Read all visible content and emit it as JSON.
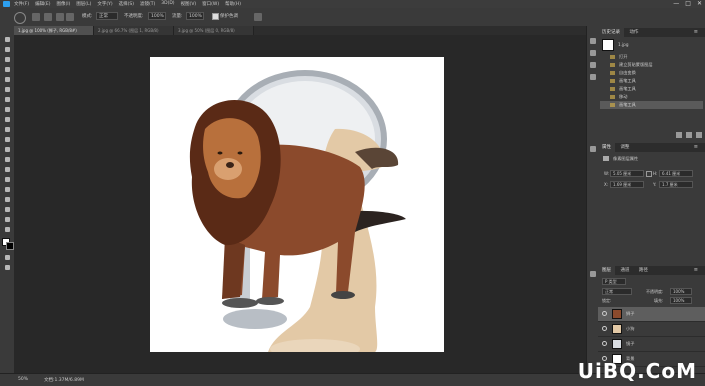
{
  "menubar": {
    "items": [
      "文件(F)",
      "编辑(E)",
      "图像(I)",
      "图层(L)",
      "文字(Y)",
      "选择(S)",
      "滤镜(T)",
      "3D(D)",
      "视图(V)",
      "窗口(W)",
      "帮助(H)"
    ]
  },
  "window_controls": {
    "minimize": "—",
    "maximize": "□",
    "close": "✕"
  },
  "options": {
    "mode_label": "模式:",
    "mode_value": "正常",
    "opacity_label": "不透明度:",
    "opacity_value": "100%",
    "flow_label": "流量:",
    "flow_value": "100%",
    "protect_tones_label": "保护色调"
  },
  "tabs": [
    {
      "label": "1.jpg @ 100% (狮子, RGB/8#)"
    },
    {
      "label": "2.jpg @ 66.7% (图层 1, RGB/8)"
    },
    {
      "label": "3.jpg @ 50% (图层 0, RGB/8)"
    }
  ],
  "status": {
    "zoom": "50%",
    "doc_info": "文档:1.37M/6.89M"
  },
  "history": {
    "tabs": [
      "历史记录",
      "动作"
    ],
    "snapshot": "1.jpg",
    "items": [
      "打开",
      "建立剪贴蒙版图层",
      "自由变换",
      "画笔工具",
      "画笔工具",
      "移动",
      "画笔工具"
    ]
  },
  "properties": {
    "tabs": [
      "属性",
      "调整"
    ],
    "title": "像素图层属性",
    "w_label": "W:",
    "w_value": "5.05 厘米",
    "h_label": "H:",
    "h_value": "6.41 厘米",
    "x_label": "X:",
    "x_value": "1.69 厘米",
    "y_label": "Y:",
    "y_value": "1.7 厘米"
  },
  "layers": {
    "tabs": [
      "图层",
      "通道",
      "路径"
    ],
    "filter_label": "P 类型",
    "blend_mode": "正常",
    "opacity_label": "不透明度:",
    "opacity_value": "100%",
    "lock_label": "锁定:",
    "fill_label": "填充:",
    "fill_value": "100%",
    "items": [
      {
        "name": "狮子",
        "active": true
      },
      {
        "name": "小狗",
        "active": false
      },
      {
        "name": "镜子",
        "active": false
      },
      {
        "name": "背景",
        "active": false
      }
    ]
  },
  "watermark": "UiBQ.CoM",
  "colors": {
    "app_bg": "#535353",
    "panel_bg": "#3a3a3a",
    "canvas_bg": "#282828",
    "accent": "#2da0f0"
  }
}
